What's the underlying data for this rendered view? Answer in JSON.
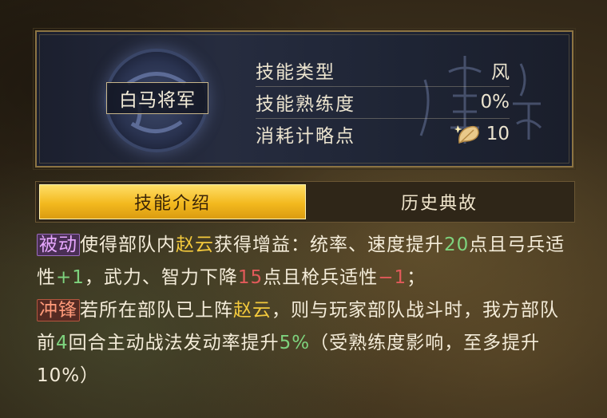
{
  "skill": {
    "name": "白马将军",
    "rows": [
      {
        "label": "技能类型",
        "value": "风"
      },
      {
        "label": "技能熟练度",
        "value": "0%"
      },
      {
        "label": "消耗计略点",
        "value": "10",
        "icon": "leaf-icon"
      }
    ]
  },
  "tabs": [
    {
      "label": "技能介绍",
      "active": true
    },
    {
      "label": "历史典故",
      "active": false
    }
  ],
  "description": {
    "passive": {
      "tag": "被动",
      "t1": "使得部队内",
      "hero": "赵云",
      "t2": "获得增益：统率、速度提升",
      "n1": "20",
      "t3": "点且弓兵适性",
      "n2": "+1",
      "t4": "，武力、智力下降",
      "n3": "15",
      "t5": "点且枪兵适性",
      "n4": "−1",
      "t6": "；"
    },
    "charge": {
      "tag": "冲锋",
      "t1": "若所在部队已上阵",
      "hero": "赵云",
      "t2": "，则与玩家部队战斗时，我方部队前",
      "n1": "4",
      "t3": "回合主动战法发动率提升",
      "n2": "5%",
      "t4": "（受熟练度影响，至多提升10%）"
    }
  },
  "colors": {
    "gold_tab": "#f3b91e",
    "hero_name": "#f3c93c",
    "increase": "#7ed37e",
    "decrease": "#e25a5a",
    "passive_tag": "#e8a8ff",
    "charge_tag": "#ff9a7a"
  }
}
